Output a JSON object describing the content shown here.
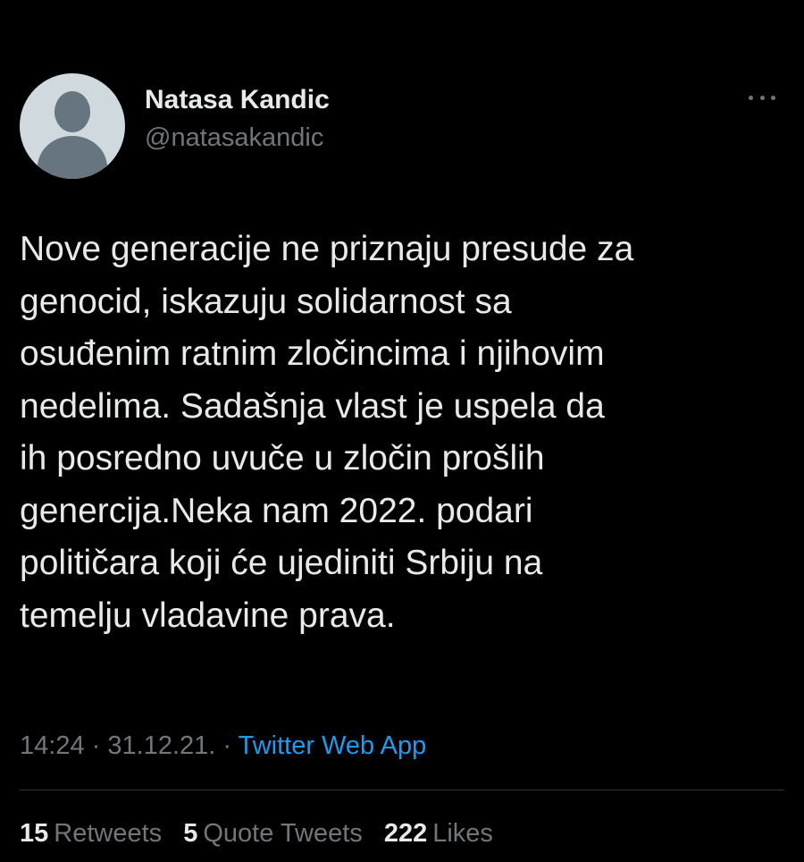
{
  "tweet": {
    "author": {
      "display_name": "Natasa Kandic",
      "handle": "@natasakandic",
      "avatar_icon": "default-avatar-icon"
    },
    "more_icon": "more-dots-icon",
    "text": "Nove generacije ne priznaju presude za\ngenocid, iskazuju solidarnost sa\nosuđenim ratnim zločincima i njihovim\nnedelima. Sadašnja vlast je uspela da\nih posredno uvuče u zločin prošlih\ngenercija.Neka nam 2022. podari\npolitičara koji će ujediniti Srbiju na\ntemelju vladavine prava.",
    "time": "14:24",
    "date": "31.12.21.",
    "separator": "·",
    "source": "Twitter Web App",
    "stats": {
      "retweets_count": "15",
      "retweets_label": "Retweets",
      "quotes_count": "5",
      "quotes_label": "Quote Tweets",
      "likes_count": "222",
      "likes_label": "Likes"
    }
  },
  "colors": {
    "background": "#000000",
    "primary_text": "#e7e9ea",
    "secondary_text": "#71767b",
    "accent": "#1d9bf0",
    "divider": "#2f3336"
  }
}
